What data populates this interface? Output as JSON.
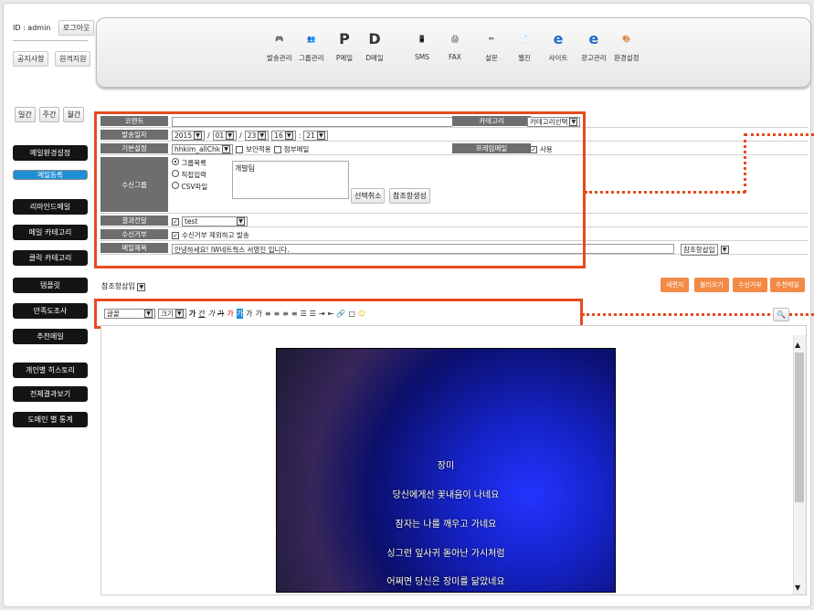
{
  "user": {
    "id_text": "ID : admin",
    "logout": "로그아웃",
    "notice": "공지사항",
    "support": "원격지원"
  },
  "top_menu": [
    "발송관리",
    "그룹관리",
    "P메일",
    "D메일",
    "SMS",
    "FAX",
    "설문",
    "웹진",
    "사이트",
    "광고관리",
    "환경설정"
  ],
  "period": [
    "일간",
    "주간",
    "월간"
  ],
  "sidebar": [
    "메일환경설정",
    "메일등록",
    "리마인드메일",
    "메일 카테고리",
    "클릭 카테고리",
    "템플릿",
    "만족도조사",
    "추천메일",
    "개인별 히스토리",
    "전체결과보기",
    "도메인 별 통계"
  ],
  "form": {
    "comment_label": "코멘트",
    "comment_value": "",
    "category_label": "카테고리",
    "category_value": "카테고리선택",
    "date_label": "발송일자",
    "year": "2015",
    "month": "01",
    "day": "23",
    "hour": "16",
    "minute": "21",
    "basic_label": "기본설정",
    "account": "hhkim_allChk",
    "secure": "보안적용",
    "attach": "첨부메일",
    "frame_label": "프레임메일",
    "use_label": "사용",
    "group_label": "수신그룹",
    "opt1": "그룹목록",
    "opt2": "직접입력",
    "opt3": "CSV파일",
    "group_item": "개발팀",
    "cancel_btn": "선택취소",
    "ref_btn": "참조항생성",
    "result_label": "결과전달",
    "result_value": "test",
    "reject_label": "수신거부",
    "reject_text": "수신거부 제외하고 발송",
    "subject_label": "메일제목",
    "subject_value": "안녕하세요! IW네트웍스 서영진 입니다.",
    "ref_insert": "참조항삽입"
  },
  "toolbar": {
    "ref_insert": "참조항삽입",
    "buttons": [
      "새편지",
      "불러오기",
      "수신거부",
      "추천메일"
    ],
    "font": "글꼴",
    "size": "크기",
    "styles": [
      "가",
      "간",
      "가",
      "가",
      "가",
      "가",
      "가",
      "가"
    ]
  },
  "poem": [
    "장미",
    "당신에게선 꽃내음이 나네요",
    "잠자는 나를 깨우고 가네요",
    "싱그런 잎사귀 돋아난 가시처럼",
    "어쩌면 당신은 장미를 닮았네요"
  ],
  "colors": {
    "accent": "#e84a1d",
    "sidebar": "#141414",
    "selected": "#1f8fd6",
    "button": "#f28a46"
  }
}
